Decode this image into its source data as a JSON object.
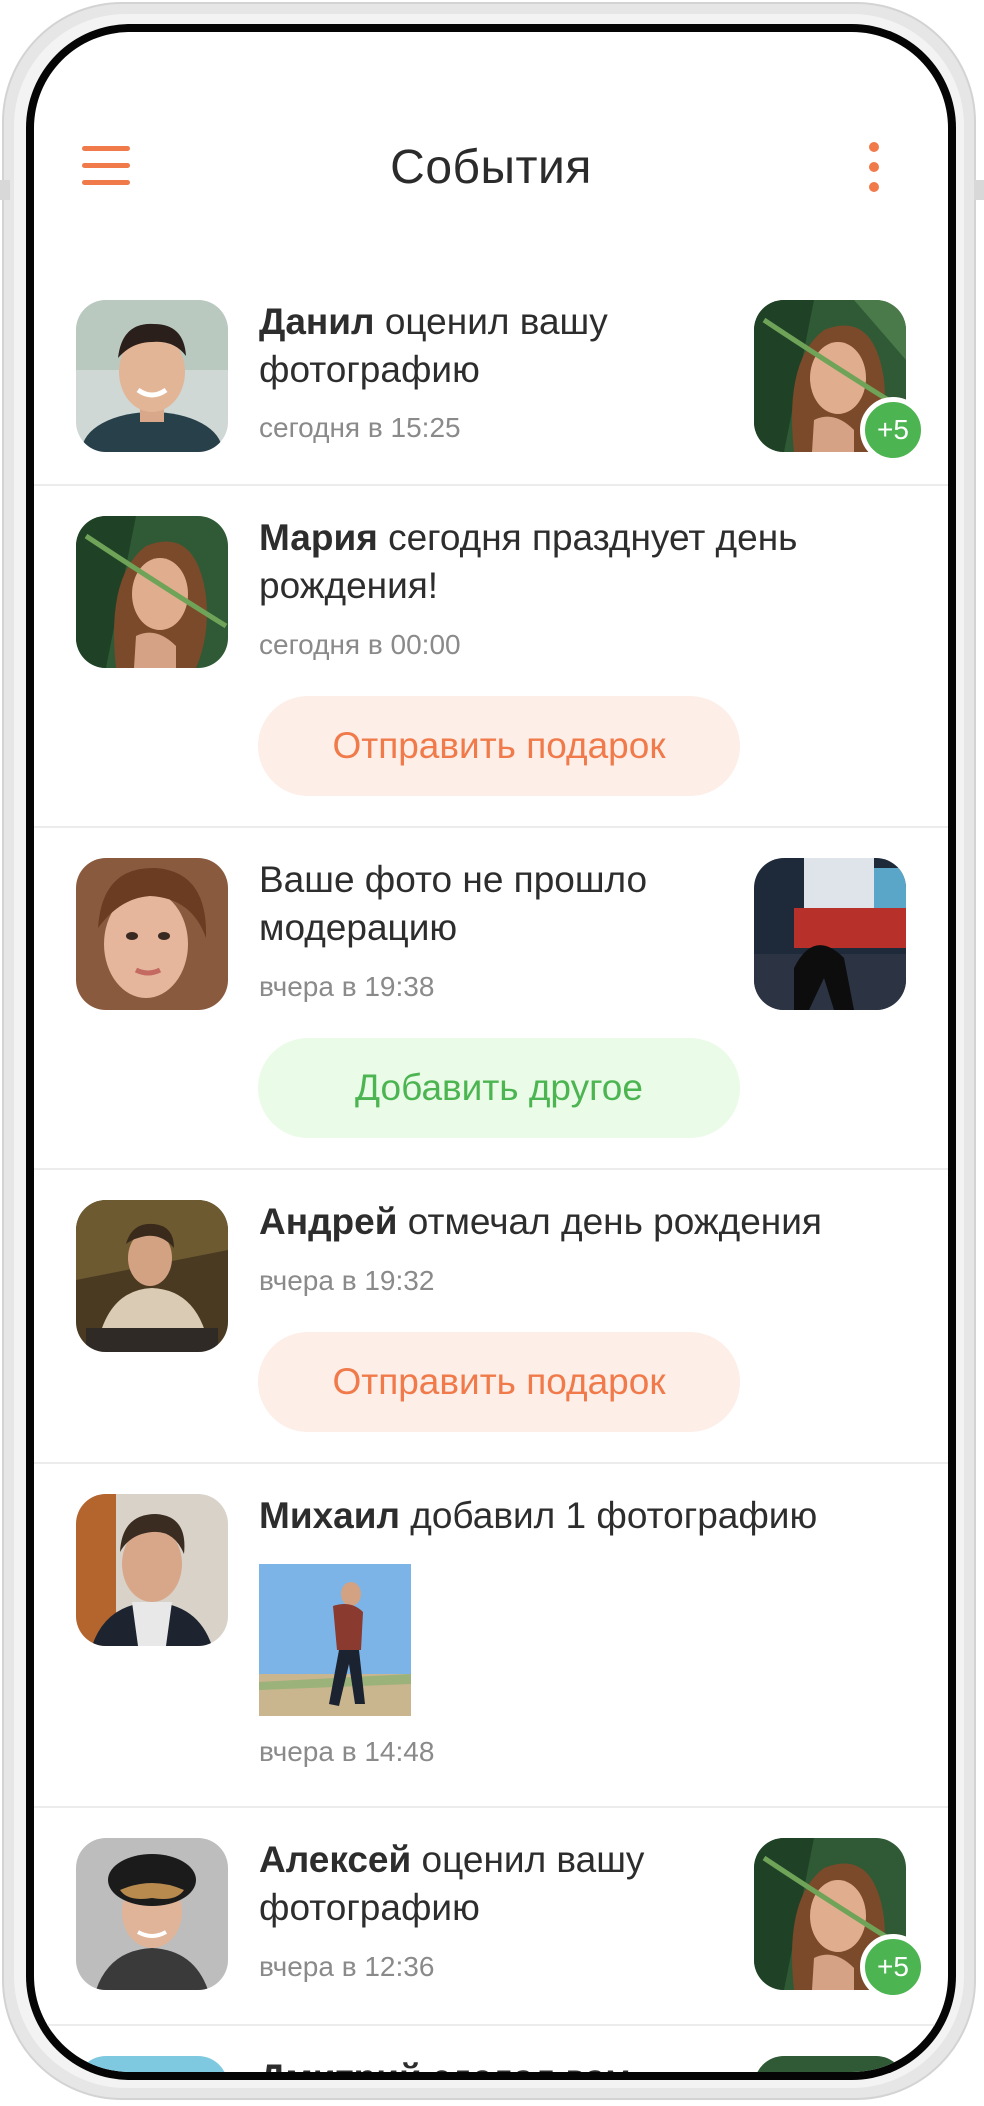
{
  "header": {
    "title": "События",
    "menu_icon": "menu-icon",
    "more_icon": "more-vertical-icon"
  },
  "colors": {
    "accent": "#f07a4a",
    "success": "#4cb552",
    "gift_button_bg": "#fdeee8",
    "add_button_bg": "#eafbe7",
    "time_text": "#8a8a8a"
  },
  "feed": [
    {
      "name": "Данил",
      "action": " оценил вашу фотографию",
      "time": "сегодня в 15:25",
      "thumb_badge": "+5"
    },
    {
      "name": "Мария",
      "action": " сегодня празднует день рождения!",
      "time": "сегодня в 00:00",
      "button": "Отправить подарок"
    },
    {
      "name": "",
      "action": "Ваше фото не прошло модерацию",
      "time": "вчера в 19:38",
      "button": "Добавить другое"
    },
    {
      "name": "Андрей",
      "action": " отмечал день рождения",
      "time": "вчера в 19:32",
      "button": "Отправить подарок"
    },
    {
      "name": "Михаил",
      "action": " добавил 1 фотографию",
      "time": "вчера в 14:48"
    },
    {
      "name": "Алексей",
      "action": " оценил вашу фотографию",
      "time": "вчера в 12:36",
      "thumb_badge": "+5"
    },
    {
      "name": "Дмитрий",
      "action": " сделал вам"
    }
  ]
}
